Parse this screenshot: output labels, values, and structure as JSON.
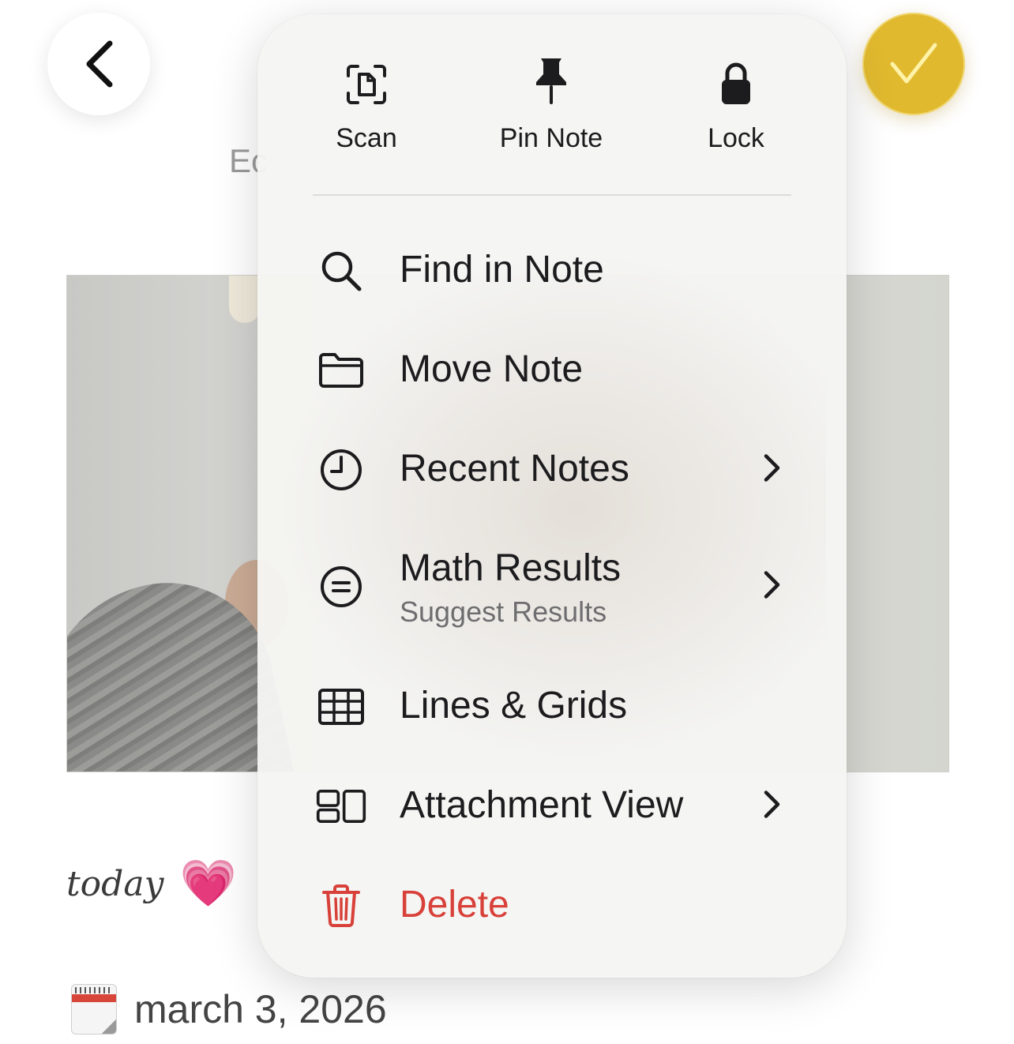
{
  "top_bar": {
    "back_icon": "chevron-left-icon",
    "done_icon": "checkmark-icon",
    "done_color": "#e0b92f",
    "partial_text": "Ec"
  },
  "note": {
    "today_label": "today",
    "heart_icon": "💗",
    "calendar_icon": "calendar-icon",
    "date_text": "march 3, 2026"
  },
  "menu": {
    "quick_actions": [
      {
        "label": "Scan",
        "icon": "scan-document-icon"
      },
      {
        "label": "Pin Note",
        "icon": "pin-icon"
      },
      {
        "label": "Lock",
        "icon": "lock-icon"
      }
    ],
    "items": [
      {
        "label": "Find in Note",
        "icon": "search-icon"
      },
      {
        "label": "Move Note",
        "icon": "folder-icon"
      },
      {
        "label": "Recent Notes",
        "icon": "clock-icon",
        "submenu": true
      },
      {
        "label": "Math Results",
        "subtitle": "Suggest Results",
        "icon": "equal-circle-icon",
        "submenu": true
      },
      {
        "label": "Lines & Grids",
        "icon": "grid-icon"
      },
      {
        "label": "Attachment View",
        "icon": "attachment-layout-icon",
        "submenu": true
      },
      {
        "label": "Delete",
        "icon": "trash-icon",
        "destructive": true,
        "color": "#d8413a"
      }
    ]
  }
}
